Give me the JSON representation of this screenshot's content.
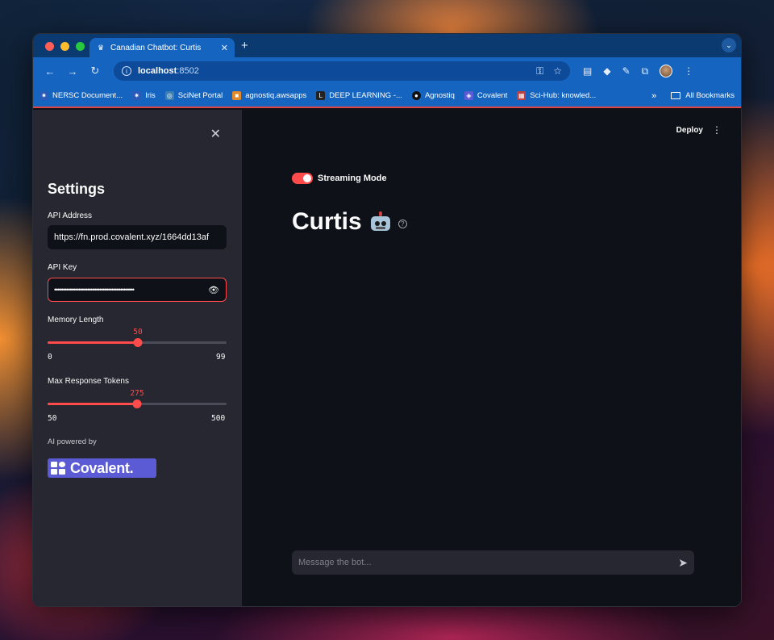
{
  "browser": {
    "tab_title": "Canadian Chatbot: Curtis",
    "tab_favicon": "streamlit-crown-icon",
    "new_tab_label": "+",
    "url_host": "localhost",
    "url_port": ":8502"
  },
  "bookmarks": {
    "items": [
      {
        "label": "NERSC Document...",
        "icon": "nersc-icon",
        "color": "#2a5bb8"
      },
      {
        "label": "Iris",
        "icon": "nersc-icon",
        "color": "#2a5bb8"
      },
      {
        "label": "SciNet Portal",
        "icon": "scinet-icon",
        "color": "#3c7fb0"
      },
      {
        "label": "agnostiq.awsapps",
        "icon": "aws-cube-icon",
        "color": "#e08a2b"
      },
      {
        "label": "DEEP LEARNING -...",
        "icon": "deep-learning-icon",
        "color": "#222222"
      },
      {
        "label": "Agnostiq",
        "icon": "github-icon",
        "color": "#111111"
      },
      {
        "label": "Covalent",
        "icon": "covalent-icon",
        "color": "#5b5bd6"
      },
      {
        "label": "Sci-Hub: knowled...",
        "icon": "scihub-icon",
        "color": "#c04040"
      }
    ],
    "more_label": "»",
    "all_label": "All Bookmarks"
  },
  "sidebar": {
    "close_label": "✕",
    "title": "Settings",
    "api_address": {
      "label": "API Address",
      "value": "https://fn.prod.covalent.xyz/1664dd13af"
    },
    "api_key": {
      "label": "API Key",
      "value": "••••••••••••••••••••••••••••••••••••••••••••••"
    },
    "memory_length": {
      "label": "Memory Length",
      "value": 50,
      "min": 0,
      "max": 99,
      "value_text": "50",
      "min_text": "0",
      "max_text": "99"
    },
    "max_tokens": {
      "label": "Max Response Tokens",
      "value": 275,
      "min": 50,
      "max": 500,
      "value_text": "275",
      "min_text": "50",
      "max_text": "500"
    },
    "powered_by": "AI powered by",
    "logo_text": "Covalent."
  },
  "main": {
    "deploy_label": "Deploy",
    "streaming_label": "Streaming Mode",
    "streaming_on": true,
    "title": "Curtis",
    "chat_placeholder": "Message the bot..."
  },
  "colors": {
    "accent": "#ff4b4b",
    "sidebar_bg": "#262730",
    "main_bg": "#0e1117",
    "browser_blue": "#1565c0"
  }
}
